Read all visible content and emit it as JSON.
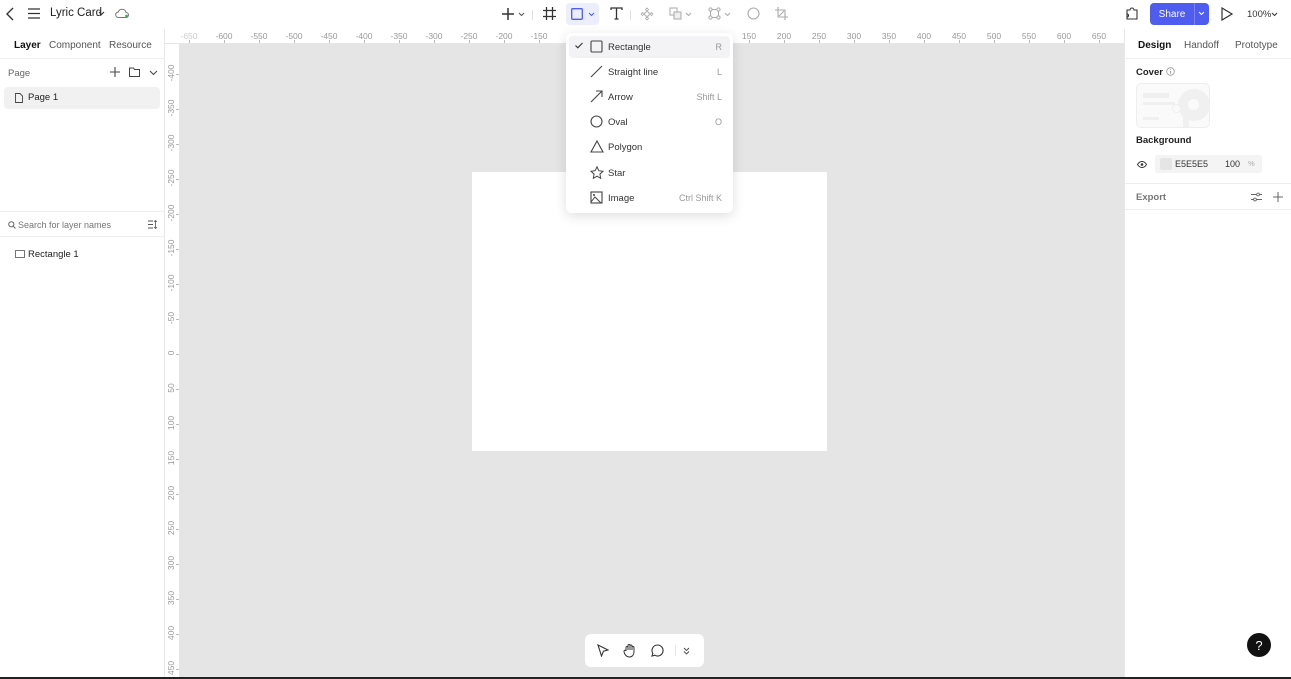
{
  "header": {
    "file_title": "Lyric Card",
    "share_label": "Share",
    "zoom_level": "100%",
    "accent_color": "#4f5cf0"
  },
  "left_panel": {
    "tabs": [
      {
        "label": "Layer",
        "active": true
      },
      {
        "label": "Component",
        "active": false
      },
      {
        "label": "Resource",
        "active": false
      }
    ],
    "page_section_label": "Page",
    "pages": [
      {
        "label": "Page 1",
        "selected": true
      }
    ],
    "search": {
      "placeholder": "Search for layer names",
      "value": ""
    },
    "layers": [
      {
        "label": "Rectangle 1",
        "icon": "rectangle-icon"
      }
    ]
  },
  "rulers": {
    "horizontal_ticks": [
      "-650",
      "-600",
      "-550",
      "-500",
      "-450",
      "-400",
      "-350",
      "-300",
      "-250",
      "-200",
      "-150",
      "150",
      "200",
      "250",
      "300",
      "350",
      "400",
      "450",
      "500",
      "550",
      "600",
      "650"
    ],
    "vertical_ticks": [
      "-400",
      "-350",
      "-300",
      "-250",
      "-200",
      "-150",
      "-100",
      "-50",
      "0",
      "50",
      "100",
      "150",
      "200",
      "250",
      "300",
      "350",
      "400",
      "450"
    ]
  },
  "shape_menu": {
    "items": [
      {
        "label": "Rectangle",
        "shortcut": "R",
        "icon": "rectangle-icon",
        "checked": true
      },
      {
        "label": "Straight line",
        "shortcut": "L",
        "icon": "line-icon",
        "checked": false
      },
      {
        "label": "Arrow",
        "shortcut": "Shift L",
        "icon": "arrow-icon",
        "checked": false
      },
      {
        "label": "Oval",
        "shortcut": "O",
        "icon": "oval-icon",
        "checked": false
      },
      {
        "label": "Polygon",
        "shortcut": "",
        "icon": "polygon-icon",
        "checked": false
      },
      {
        "label": "Star",
        "shortcut": "",
        "icon": "star-icon",
        "checked": false
      },
      {
        "label": "Image",
        "shortcut": "Ctrl Shift K",
        "icon": "image-icon",
        "checked": false
      }
    ]
  },
  "right_panel": {
    "tabs": [
      {
        "label": "Design",
        "active": true
      },
      {
        "label": "Handoff",
        "active": false
      },
      {
        "label": "Prototype",
        "active": false
      }
    ],
    "cover_label": "Cover",
    "background_label": "Background",
    "background_color_hex": "E5E5E5",
    "background_opacity": "100",
    "opacity_unit": "%",
    "export_label": "Export"
  },
  "help_label": "?"
}
